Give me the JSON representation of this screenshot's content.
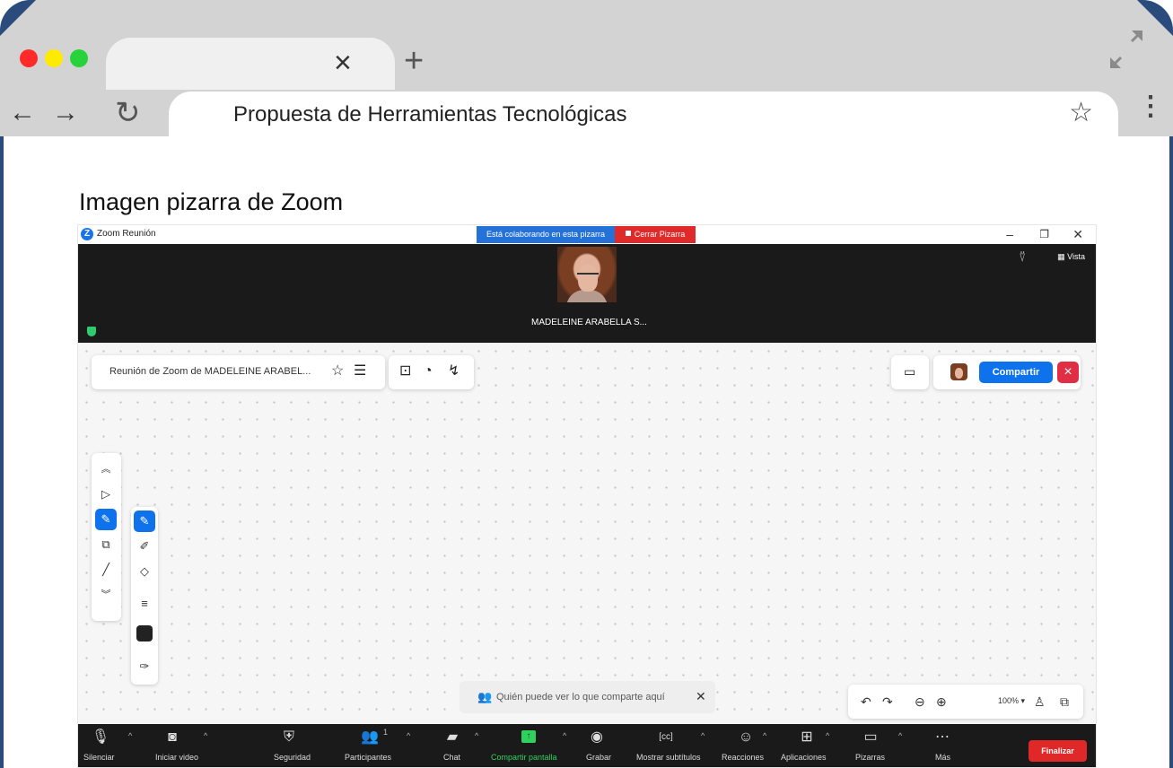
{
  "browser": {
    "url_text": "Propuesta de Herramientas Tecnológicas",
    "tab_close_icon": "close-icon",
    "new_tab_icon": "plus-icon"
  },
  "section": {
    "title": "Imagen pizarra de Zoom"
  },
  "zoom": {
    "window_title": "Zoom Reunión",
    "collab_banner": "Está colaborando en esta pizarra",
    "close_whiteboard": "Cerrar Pizarra",
    "participant_name": "MADELEINE ARABELLA S...",
    "view_label": "Vista",
    "whiteboard_title": "Reunión de Zoom de MADELEINE ARABEL...",
    "share_label": "Compartir",
    "notice_text": "Quién puede ver lo que comparte aquí",
    "zoom_level": "100%",
    "controls": [
      {
        "label": "Silenciar"
      },
      {
        "label": "Iniciar video"
      },
      {
        "label": "Seguridad"
      },
      {
        "label": "Participantes",
        "count": "1"
      },
      {
        "label": "Chat"
      },
      {
        "label": "Compartir pantalla"
      },
      {
        "label": "Grabar"
      },
      {
        "label": "Mostrar subtítulos"
      },
      {
        "label": "Reacciones"
      },
      {
        "label": "Aplicaciones"
      },
      {
        "label": "Pizarras"
      },
      {
        "label": "Más"
      }
    ],
    "end_label": "Finalizar"
  },
  "colors": {
    "accent_blue": "#0e72ed",
    "danger_red": "#e02f44",
    "share_green": "#2fd15e",
    "frame_blue": "#2a4b7c"
  }
}
